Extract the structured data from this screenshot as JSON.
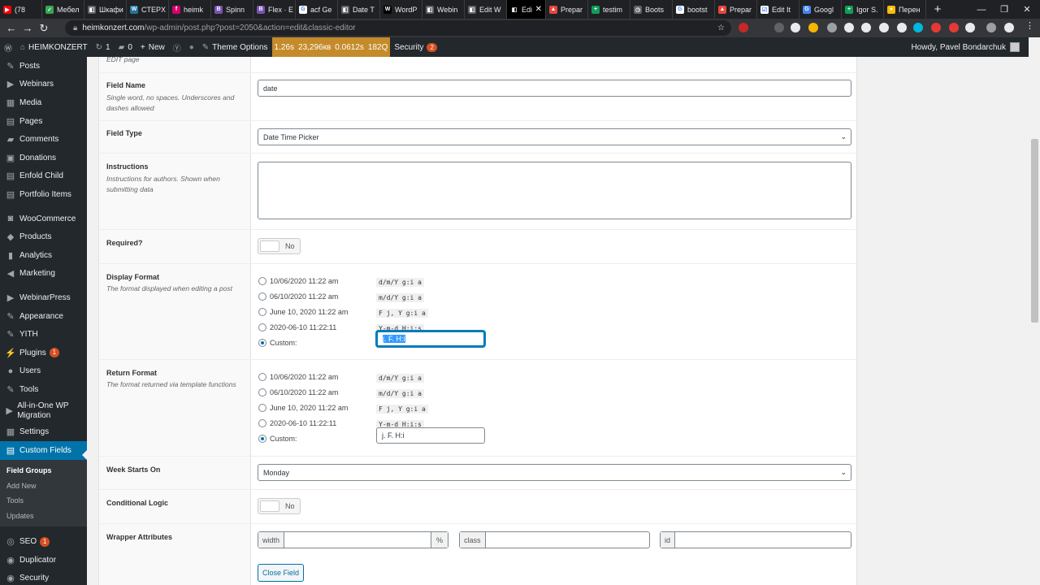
{
  "browser": {
    "tabs": [
      {
        "label": "(78",
        "color": "#ff0000",
        "glyph": "▶"
      },
      {
        "label": "Мебел",
        "color": "#34a853",
        "glyph": "✓"
      },
      {
        "label": "Шкафи",
        "color": "#5f6368",
        "glyph": "◧"
      },
      {
        "label": "CTEPX",
        "color": "#21759b",
        "glyph": "W"
      },
      {
        "label": "heimk",
        "color": "#d5006d",
        "glyph": "f"
      },
      {
        "label": "Spinn",
        "color": "#7952b3",
        "glyph": "B"
      },
      {
        "label": "Flex · E",
        "color": "#7952b3",
        "glyph": "B"
      },
      {
        "label": "acf Ge",
        "color": "#ffffff",
        "glyph": "G"
      },
      {
        "label": "Date T",
        "color": "#5f6368",
        "glyph": "◧"
      },
      {
        "label": "WordP",
        "color": "#000000",
        "glyph": "W"
      },
      {
        "label": "Webin",
        "color": "#5f6368",
        "glyph": "◧"
      },
      {
        "label": "Edit W",
        "color": "#5f6368",
        "glyph": "◧"
      },
      {
        "label": "Edi",
        "color": "#000000",
        "glyph": "◧",
        "active": true
      },
      {
        "label": "Prepar",
        "color": "#e8453c",
        "glyph": "▲"
      },
      {
        "label": "testim",
        "color": "#0f9d58",
        "glyph": "+"
      },
      {
        "label": "Boots",
        "color": "#5f6368",
        "glyph": "◷"
      },
      {
        "label": "bootst",
        "color": "#ffffff",
        "glyph": "G"
      },
      {
        "label": "Prepar",
        "color": "#e8453c",
        "glyph": "▲"
      },
      {
        "label": "Edit It",
        "color": "#ffffff",
        "glyph": "☑"
      },
      {
        "label": "Googl",
        "color": "#4285f4",
        "glyph": "G"
      },
      {
        "label": "Igor S.",
        "color": "#0f9d58",
        "glyph": "+"
      },
      {
        "label": "Перен",
        "color": "#fbbc05",
        "glyph": "●"
      }
    ],
    "new_tab": "+",
    "url_host": "heimkonzert.com",
    "url_path": "/wp-admin/post.php?post=2050&action=edit&classic-editor"
  },
  "adminbar": {
    "site_name": "HEIMKONZERT",
    "updates_count": "1",
    "comments_count": "0",
    "new_label": "New",
    "theme_options": "Theme Options",
    "perf": [
      "1.26s",
      "23,296кв",
      "0.0612s",
      "182Q"
    ],
    "security_label": "Security",
    "security_count": "2",
    "howdy": "Howdy, Pavel Bondarchuk"
  },
  "sidebar": {
    "items": [
      {
        "label": "Posts",
        "icon": "pin-icon",
        "glyph": "✎"
      },
      {
        "label": "Webinars",
        "icon": "video-icon",
        "glyph": "▶"
      },
      {
        "label": "Media",
        "icon": "media-icon",
        "glyph": "▦"
      },
      {
        "label": "Pages",
        "icon": "pages-icon",
        "glyph": "▤"
      },
      {
        "label": "Comments",
        "icon": "comments-icon",
        "glyph": "▰"
      },
      {
        "label": "Donations",
        "icon": "donations-icon",
        "glyph": "▣"
      },
      {
        "label": "Enfold Child",
        "icon": "enfold-icon",
        "glyph": "▤"
      },
      {
        "label": "Portfolio Items",
        "icon": "portfolio-icon",
        "glyph": "▤"
      }
    ],
    "items2": [
      {
        "label": "WooCommerce",
        "icon": "woocommerce-icon",
        "glyph": "◙"
      },
      {
        "label": "Products",
        "icon": "products-icon",
        "glyph": "◆"
      },
      {
        "label": "Analytics",
        "icon": "analytics-icon",
        "glyph": "▮"
      },
      {
        "label": "Marketing",
        "icon": "marketing-icon",
        "glyph": "◀"
      }
    ],
    "items3": [
      {
        "label": "WebinarPress",
        "icon": "webinarpress-icon",
        "glyph": "▶"
      },
      {
        "label": "Appearance",
        "icon": "appearance-icon",
        "glyph": "✎"
      },
      {
        "label": "YITH",
        "icon": "yith-icon",
        "glyph": "✎"
      },
      {
        "label": "Plugins",
        "icon": "plugins-icon",
        "glyph": "⚡",
        "badge": "1"
      },
      {
        "label": "Users",
        "icon": "users-icon",
        "glyph": "●"
      },
      {
        "label": "Tools",
        "icon": "tools-icon",
        "glyph": "✎"
      },
      {
        "label": "All-in-One WP Migration",
        "icon": "migration-icon",
        "glyph": "▶"
      },
      {
        "label": "Settings",
        "icon": "settings-icon",
        "glyph": "▦"
      },
      {
        "label": "Custom Fields",
        "icon": "custom-fields-icon",
        "glyph": "▤"
      }
    ],
    "submenu": [
      "Field Groups",
      "Add New",
      "Tools",
      "Updates"
    ],
    "items4": [
      {
        "label": "SEO",
        "icon": "seo-icon",
        "glyph": "◎",
        "badge": "1"
      },
      {
        "label": "Duplicator",
        "icon": "duplicator-icon",
        "glyph": "◉"
      },
      {
        "label": "Security",
        "icon": "security-icon",
        "glyph": "◉"
      }
    ]
  },
  "field": {
    "top_note": "EDIT page",
    "name_label": "Field Name",
    "name_desc": "Single word, no spaces. Underscores and dashes allowed",
    "name_value": "date",
    "type_label": "Field Type",
    "type_value": "Date Time Picker",
    "instructions_label": "Instructions",
    "instructions_desc": "Instructions for authors. Shown when submitting data",
    "required_label": "Required?",
    "required_value": "No",
    "display_label": "Display Format",
    "display_desc": "The format displayed when editing a post",
    "return_label": "Return Format",
    "return_desc": "The format returned via template functions",
    "formats": [
      {
        "label": "10/06/2020 11:22 am",
        "code": "d/m/Y g:i a"
      },
      {
        "label": "06/10/2020 11:22 am",
        "code": "m/d/Y g:i a"
      },
      {
        "label": "June 10, 2020 11:22 am",
        "code": "F j, Y g:i a"
      },
      {
        "label": "2020-06-10 11:22:11",
        "code": "Y-m-d H:i:s"
      }
    ],
    "custom_label": "Custom:",
    "display_custom_value": "j. F. H:i",
    "return_custom_value": "j. F. H:i",
    "week_label": "Week Starts On",
    "week_value": "Monday",
    "conditional_label": "Conditional Logic",
    "conditional_value": "No",
    "wrapper_label": "Wrapper Attributes",
    "wrapper_width": "width",
    "wrapper_percent": "%",
    "wrapper_class": "class",
    "wrapper_id": "id",
    "close_button": "Close Field"
  }
}
